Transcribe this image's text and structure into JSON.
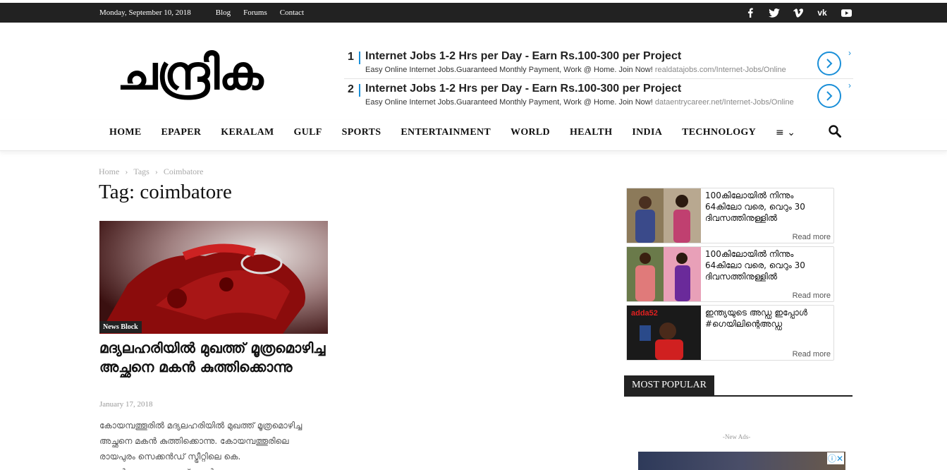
{
  "topbar": {
    "date": "Monday, September 10, 2018",
    "links": [
      "Blog",
      "Forums",
      "Contact"
    ],
    "social_icons": [
      "facebook-icon",
      "twitter-icon",
      "vimeo-icon",
      "vk-icon",
      "youtube-icon"
    ]
  },
  "logo": {
    "text": "ചന്ദ്രിക"
  },
  "ads": {
    "rows": [
      {
        "num": "1",
        "title": "Internet Jobs 1-2 Hrs per Day - Earn Rs.100-300 per Project",
        "desc": "Easy Online Internet Jobs.Guaranteed Monthly Payment, Work @ Home. Join Now!",
        "url": "realdatajobs.com/Internet-Jobs/Online"
      },
      {
        "num": "2",
        "title": "Internet Jobs 1-2 Hrs per Day - Earn Rs.100-300 per Project",
        "desc": "Easy Online Internet Jobs.Guaranteed Monthly Payment, Work @ Home. Join Now!",
        "url": "dataentrycareer.net/Internet-Jobs/Online"
      }
    ]
  },
  "nav": {
    "items": [
      "HOME",
      "EPAPER",
      "KERALAM",
      "GULF",
      "SPORTS",
      "ENTERTAINMENT",
      "WORLD",
      "HEALTH",
      "INDIA",
      "TECHNOLOGY"
    ],
    "more": "≡ ⌄"
  },
  "breadcrumb": {
    "home": "Home",
    "sep": "›",
    "tags": "Tags",
    "current": "Coimbatore"
  },
  "page_title": "Tag: coimbatore",
  "article": {
    "category": "News Block",
    "title": "മദ്യലഹരിയിൽ മുഖത്ത് മൂത്രമൊഴിച്ച അച്ഛനെ മകൻ കുത്തിക്കൊന്നു",
    "date": "January 17, 2018",
    "excerpt": "കോയമ്പത്തൂരിൽ മദ്യലഹരിയിൽ മുഖത്ത് മൂത്രമൊഴിച്ച അച്ഛനെ മകൻ കുത്തിക്കൊന്നു. കോയമ്പത്തൂരിലെ രായപുരം സെക്കൻഡ് സ്ട്രീറ്റിലെ കെ. സെൽവരാജനെയാണ് മകൻ"
  },
  "promos": [
    {
      "title": "100കിലോയിൽ നിന്നും 64കിലോ വരെ, വെറും 30 ദിവസത്തിനുള്ളിൽ",
      "readmore": "Read more"
    },
    {
      "title": "100കിലോയിൽ നിന്നും 64കിലോ വരെ, വെറും 30 ദിവസത്തിനുള്ളിൽ",
      "readmore": "Read more"
    },
    {
      "title": "ഇന്ത്യയുടെ അഡ്ഡ ഇപ്പോൾ #ഗെയിലിന്റെഅഡ്ഡ",
      "readmore": "Read more",
      "brand": "adda52"
    }
  ],
  "most_popular": "MOST POPULAR",
  "new_ads": "-New Ads-",
  "colors": {
    "topbar": "#222222",
    "accent": "#1a8fd8"
  }
}
